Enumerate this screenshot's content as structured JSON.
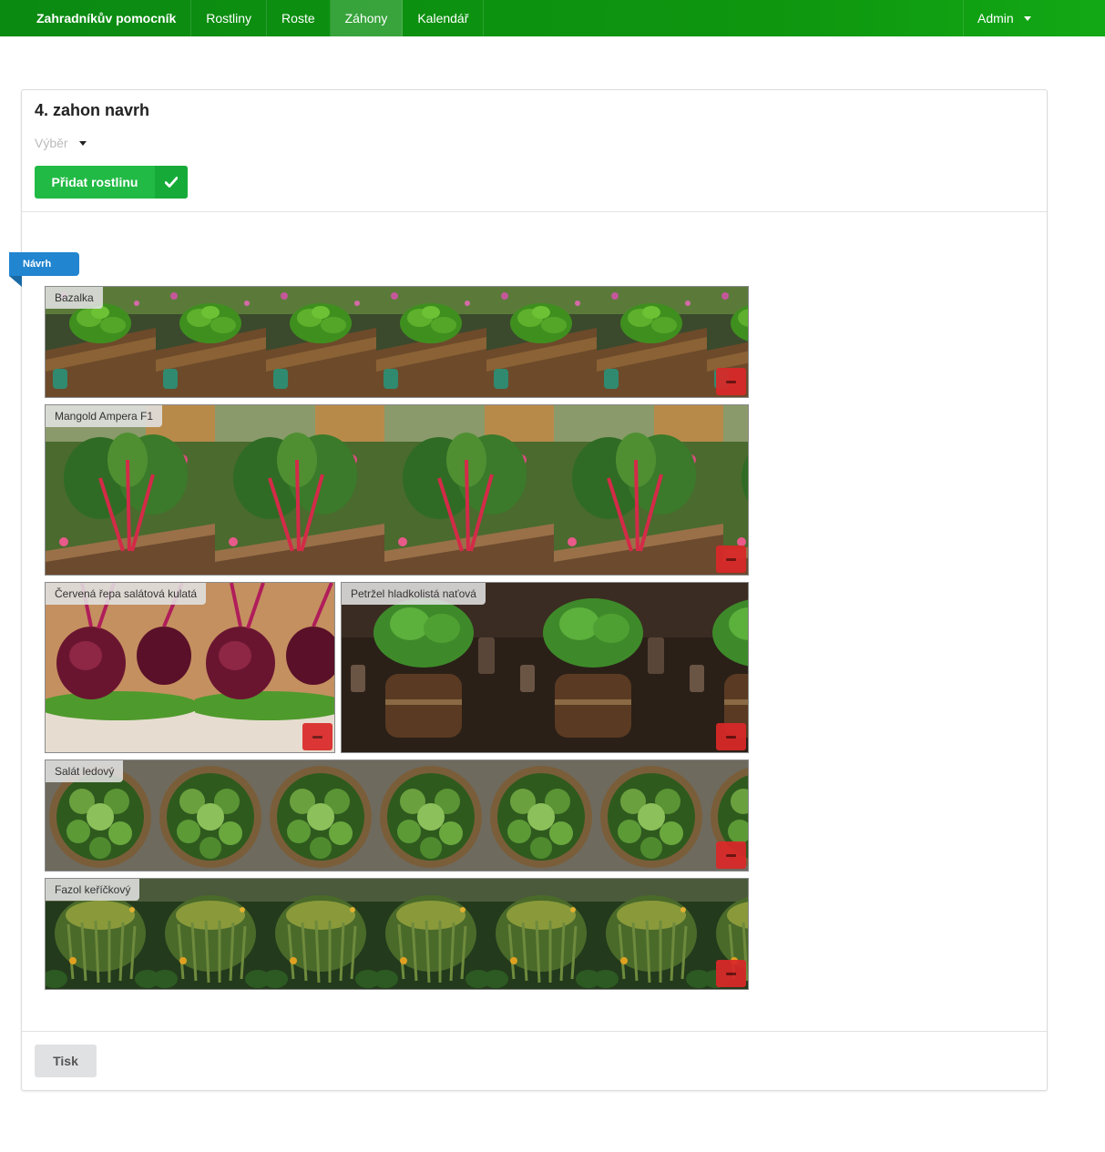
{
  "nav": {
    "brand": "Zahradníkův pomocník",
    "items": [
      "Rostliny",
      "Roste",
      "Záhony",
      "Kalendář"
    ],
    "active": "Záhony",
    "user": "Admin"
  },
  "bed": {
    "title": "4. zahon navrh",
    "select_placeholder": "Výběr",
    "add_button": "Přidat rostlinu",
    "ribbon": "Návrh",
    "print_button": "Tisk"
  },
  "plants": [
    {
      "name": "Bazalka",
      "icon": "basil-photo"
    },
    {
      "name": "Mangold Ampera F1",
      "icon": "chard-photo"
    },
    {
      "name": "Červená řepa salátová kulatá",
      "icon": "beetroot-photo"
    },
    {
      "name": "Petržel hladkolistá naťová",
      "icon": "parsley-photo"
    },
    {
      "name": "Salát ledový",
      "icon": "lettuce-photo"
    },
    {
      "name": "Fazol keříčkový",
      "icon": "bean-photo"
    }
  ],
  "colors": {
    "navbar": "#0e960f",
    "add_button": "#21ba45",
    "ribbon": "#2185d0",
    "delete_button": "#db2828"
  }
}
